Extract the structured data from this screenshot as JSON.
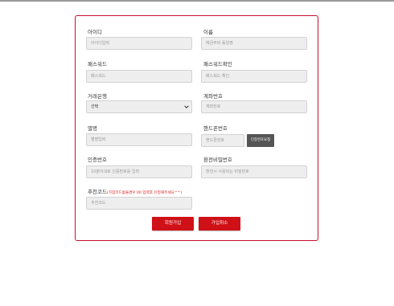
{
  "form": {
    "left": [
      {
        "label": "아이디",
        "placeholder": "아이디입력"
      },
      {
        "label": "패스워드",
        "placeholder": "패스워드"
      },
      {
        "label": "거래은행",
        "value": "선택"
      },
      {
        "label": "별명",
        "placeholder": "별명입력"
      },
      {
        "label": "인증번호",
        "placeholder": "10분이내로 인증번호를 입력"
      }
    ],
    "right": [
      {
        "label": "이름",
        "placeholder": "예금주와 동일명"
      },
      {
        "label": "패스워드확인",
        "placeholder": "패스워드 확인"
      },
      {
        "label": "계좌번호",
        "placeholder": "계좌번호"
      },
      {
        "label": "핸드폰번호",
        "placeholder": "핸드폰번호",
        "button": "인증번호요청"
      },
      {
        "label": "환전비밀번호",
        "placeholder": "환전시 사용되는 비밀번호"
      }
    ],
    "referral": {
      "label": "추천코드",
      "hint": "(가입코드없을경우 00 입력후 신청해주세요^^)",
      "placeholder": "추천코드"
    }
  },
  "buttons": {
    "register": "회원가입",
    "cancel": "가입취소"
  },
  "colors": {
    "accent": "#d01017",
    "border": "#c8102e"
  }
}
